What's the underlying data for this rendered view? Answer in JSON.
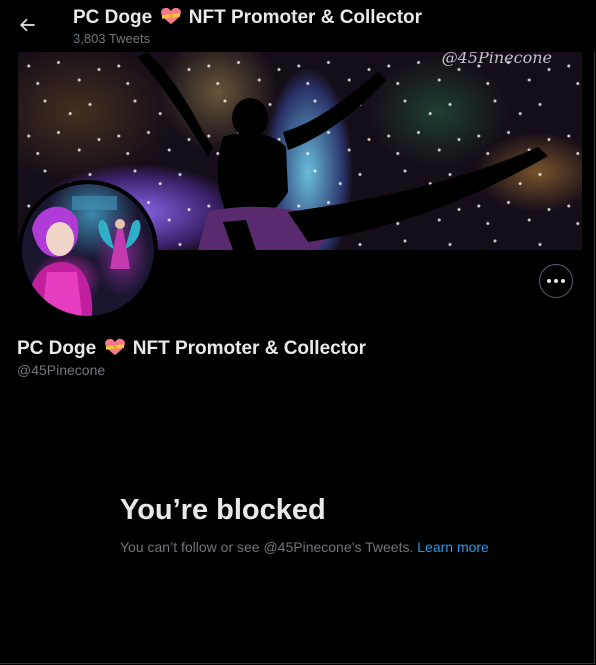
{
  "header": {
    "back_icon": "arrow-left-icon",
    "name_prefix": "PC Doge",
    "name_suffix": "NFT Promoter & Collector",
    "tweet_count": "3,803 Tweets"
  },
  "banner": {
    "watermark": "@45Pinecone"
  },
  "profile": {
    "name_prefix": "PC Doge",
    "name_suffix": "NFT Promoter & Collector",
    "handle": "@45Pinecone",
    "more_icon": "more-horizontal-icon",
    "emoji_icon": "heart-with-ribbon-icon"
  },
  "blocked": {
    "title": "You’re blocked",
    "message": "You can’t follow or see @45Pinecone’s Tweets.",
    "link_label": "Learn more"
  },
  "colors": {
    "background": "#000000",
    "primary_text": "#e7e9ea",
    "secondary_text": "#71767b",
    "link": "#1d9bf0"
  }
}
